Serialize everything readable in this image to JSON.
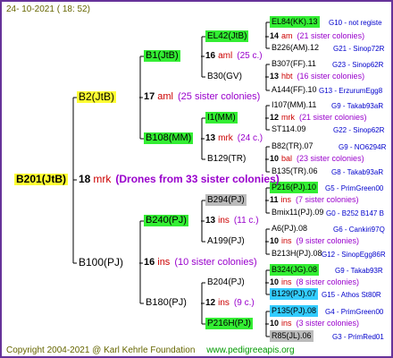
{
  "header": {
    "date": "24- 10-2021 ( 18: 52)"
  },
  "footer": {
    "copyright": "Copyright 2004-2021 @ Karl Kehrle Foundation",
    "url": "www.pedigreeapis.org"
  },
  "nodes": [
    {
      "id": "B201",
      "text": "B201(JtB)",
      "style": "yellow",
      "fs": 12,
      "bold": true
    },
    {
      "id": "B2",
      "text": "B2(JtB)",
      "style": "yellow",
      "fs": 12
    },
    {
      "id": "B100",
      "text": "B100(PJ)",
      "style": "",
      "fs": 12
    },
    {
      "id": "B1",
      "text": "B1(JtB)",
      "style": "green",
      "fs": 11
    },
    {
      "id": "B108",
      "text": "B108(MM)",
      "style": "green",
      "fs": 11
    },
    {
      "id": "B240",
      "text": "B240(PJ)",
      "style": "green",
      "fs": 11
    },
    {
      "id": "B180",
      "text": "B180(PJ)",
      "style": "",
      "fs": 11
    },
    {
      "id": "EL42",
      "text": "EL42(JtB)",
      "style": "green",
      "fs": 10
    },
    {
      "id": "B30",
      "text": "B30(GV)",
      "style": "",
      "fs": 10
    },
    {
      "id": "I1MM",
      "text": "I1(MM)",
      "style": "green",
      "fs": 10
    },
    {
      "id": "B129",
      "text": "B129(TR)",
      "style": "",
      "fs": 10
    },
    {
      "id": "B294",
      "text": "B294(PJ)",
      "style": "grayb",
      "fs": 10
    },
    {
      "id": "A199",
      "text": "A199(PJ)",
      "style": "",
      "fs": 10
    },
    {
      "id": "B204",
      "text": "B204(PJ)",
      "style": "",
      "fs": 10
    },
    {
      "id": "P216H",
      "text": "P216H(PJ)",
      "style": "green",
      "fs": 10
    },
    {
      "id": "EL84",
      "text": "EL84(KK).13",
      "style": "green",
      "fs": 9
    },
    {
      "id": "B226",
      "text": "B226(AM).12",
      "style": "",
      "fs": 9
    },
    {
      "id": "B307",
      "text": "B307(FF).11",
      "style": "",
      "fs": 9
    },
    {
      "id": "A144",
      "text": "A144(FF).10",
      "style": "",
      "fs": 9
    },
    {
      "id": "I107",
      "text": "I107(MM).11",
      "style": "",
      "fs": 9
    },
    {
      "id": "ST114",
      "text": "ST114.09",
      "style": "",
      "fs": 9
    },
    {
      "id": "B82",
      "text": "B82(TR).07",
      "style": "",
      "fs": 9
    },
    {
      "id": "B135",
      "text": "B135(TR).06",
      "style": "",
      "fs": 9
    },
    {
      "id": "P216PJ",
      "text": "P216(PJ).10",
      "style": "green",
      "fs": 9
    },
    {
      "id": "Bmix11",
      "text": "Bmix11(PJ).09",
      "style": "",
      "fs": 9
    },
    {
      "id": "A6",
      "text": "A6(PJ).08",
      "style": "",
      "fs": 9
    },
    {
      "id": "B213H",
      "text": "B213H(PJ).08",
      "style": "",
      "fs": 9
    },
    {
      "id": "B324",
      "text": "B324(JG).08",
      "style": "green",
      "fs": 9
    },
    {
      "id": "B129PJ",
      "text": "B129(PJ).07",
      "style": "cyan",
      "fs": 9
    },
    {
      "id": "P135",
      "text": "P135(PJ).08",
      "style": "cyan",
      "fs": 9
    },
    {
      "id": "R85",
      "text": "R85(JL).06",
      "style": "grayb",
      "fs": 9
    }
  ],
  "drones": [
    {
      "id": "d-B201",
      "num": "18",
      "code": "mrk",
      "info": "(Drones from 33 sister colonies)",
      "fs": 12,
      "infoBold": true
    },
    {
      "id": "d-B2",
      "num": "17",
      "code": "aml",
      "info": "(25 sister colonies)",
      "fs": 11
    },
    {
      "id": "d-B100",
      "num": "16",
      "code": "ins",
      "info": "(10 sister colonies)",
      "fs": 11
    },
    {
      "id": "d-B1",
      "num": "16",
      "code": "aml",
      "info": "(25 c.)",
      "fs": 10
    },
    {
      "id": "d-B108",
      "num": "13",
      "code": "mrk",
      "info": "(24 c.)",
      "fs": 10
    },
    {
      "id": "d-B240",
      "num": "13",
      "code": "ins",
      "info": "(11 c.)",
      "fs": 10
    },
    {
      "id": "d-B180",
      "num": "12",
      "code": "ins",
      "info": "(9 c.)",
      "fs": 10
    },
    {
      "id": "d-EL42",
      "num": "14",
      "code": "am",
      "info": "(21 sister colonies)",
      "fs": 9
    },
    {
      "id": "d-B30",
      "num": "13",
      "code": "hbt",
      "info": "(16 sister colonies)",
      "fs": 9
    },
    {
      "id": "d-I1",
      "num": "12",
      "code": "mrk",
      "info": "(21 sister colonies)",
      "fs": 9
    },
    {
      "id": "d-B129",
      "num": "10",
      "code": "bal",
      "info": "(23 sister colonies)",
      "fs": 9
    },
    {
      "id": "d-B294",
      "num": "11",
      "code": "ins",
      "info": "(7 sister colonies)",
      "fs": 9
    },
    {
      "id": "d-A199",
      "num": "10",
      "code": "ins",
      "info": "(9 sister colonies)",
      "fs": 9
    },
    {
      "id": "d-B204",
      "num": "10",
      "code": "ins",
      "info": "(8 sister colonies)",
      "fs": 9
    },
    {
      "id": "d-P216H",
      "num": "10",
      "code": "ins",
      "info": "(3 sister colonies)",
      "fs": 9
    }
  ],
  "refs": [
    {
      "id": "r-EL84",
      "text": "G10 - not registe"
    },
    {
      "id": "r-B226",
      "text": "G21 - Sinop72R"
    },
    {
      "id": "r-B307",
      "text": "G23 - Sinop62R"
    },
    {
      "id": "r-A144",
      "text": "G13 - ErzurumEgg8"
    },
    {
      "id": "r-I107",
      "text": "G9 - Takab93aR"
    },
    {
      "id": "r-ST114",
      "text": "G22 - Sinop62R"
    },
    {
      "id": "r-B82",
      "text": "G9 - NO6294R"
    },
    {
      "id": "r-B135",
      "text": "G8 - Takab93aR"
    },
    {
      "id": "r-P216PJ",
      "text": "G5 - PrimGreen00"
    },
    {
      "id": "r-Bmix11",
      "text": "G0 - B252 B147 B"
    },
    {
      "id": "r-A6",
      "text": "G6 - Cankiri97Q"
    },
    {
      "id": "r-B213H",
      "text": "G12 - SinopEgg86R"
    },
    {
      "id": "r-B324",
      "text": "G9 - Takab93R"
    },
    {
      "id": "r-B129PJ",
      "text": "G15 - Athos St80R"
    },
    {
      "id": "r-P135",
      "text": "G4 - PrimGreen00"
    },
    {
      "id": "r-R85",
      "text": "G3 - PrimRed01"
    }
  ]
}
